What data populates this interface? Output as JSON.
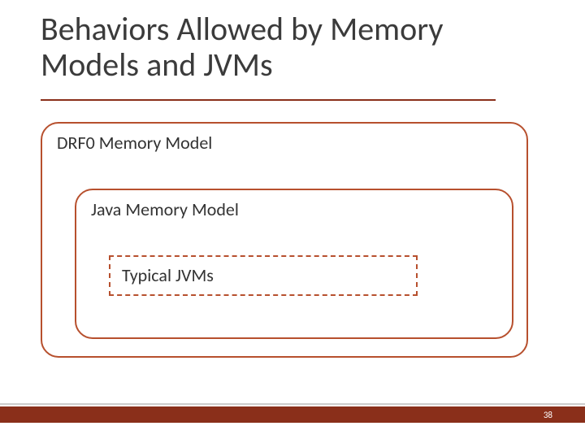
{
  "title": "Behaviors Allowed by Memory Models and JVMs",
  "diagram": {
    "outer": {
      "label": "DRF0 Memory Model"
    },
    "mid": {
      "label": "Java Memory Model"
    },
    "inner": {
      "label": "Typical JVMs"
    }
  },
  "page_number": "38",
  "colors": {
    "accent": "#8a2f1a",
    "border": "#b7502e"
  }
}
